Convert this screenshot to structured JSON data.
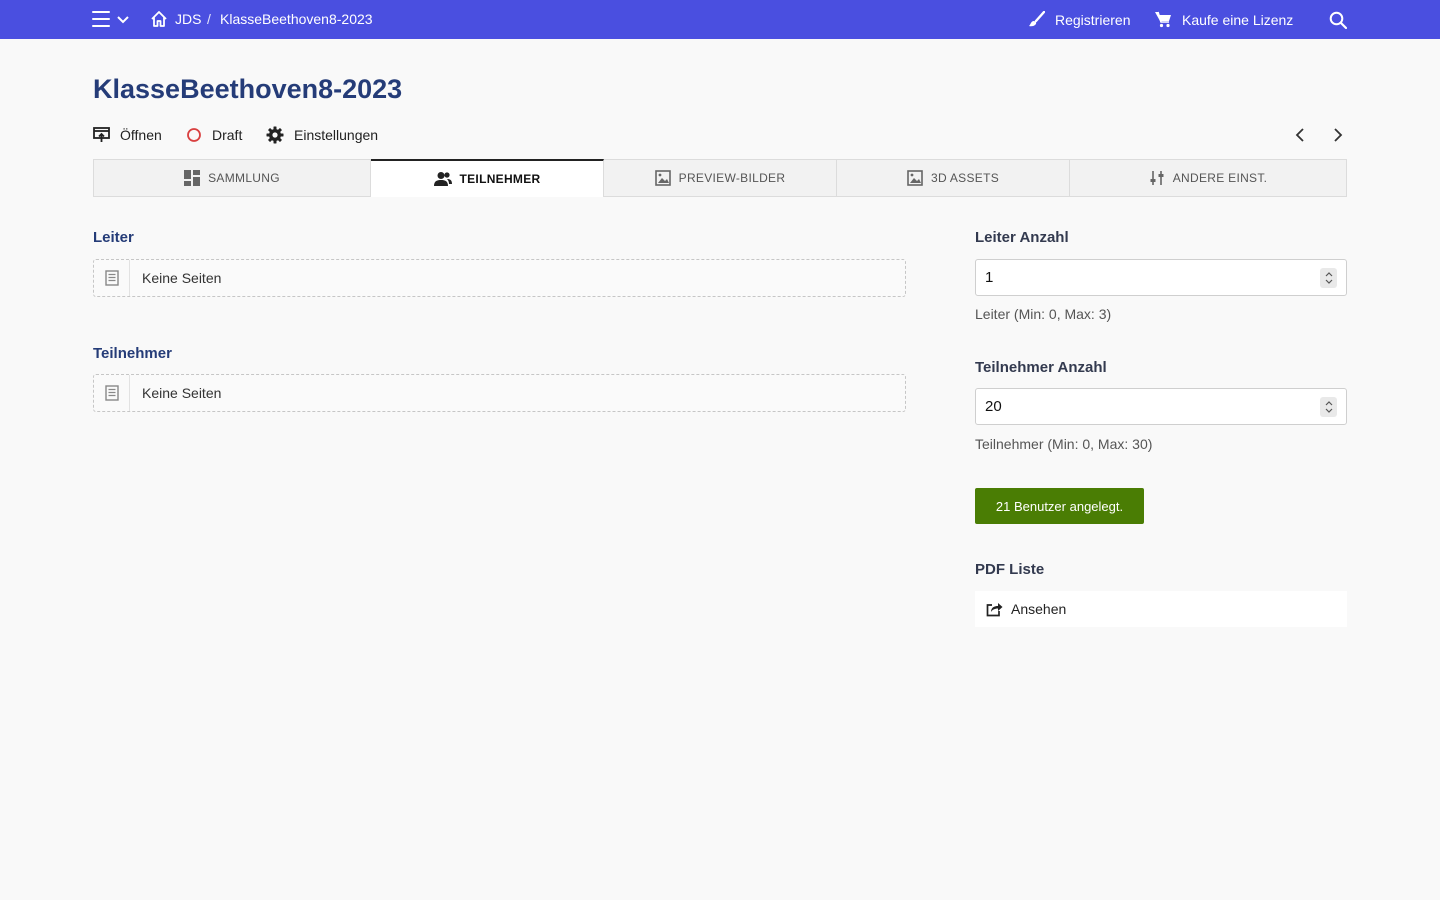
{
  "colors": {
    "topbar": "#4a4fe0",
    "title": "#253c78",
    "success": "#4a7d04",
    "draft": "#d94040"
  },
  "topbar": {
    "menu_icon": "hamburger-icon",
    "breadcrumb": [
      {
        "label": "JDS"
      },
      {
        "label": "KlasseBeethoven8-2023"
      }
    ],
    "separator": "/",
    "register_label": "Registrieren",
    "license_label": "Kaufe eine Lizenz"
  },
  "page": {
    "title": "KlasseBeethoven8-2023",
    "actions": {
      "open_label": "Öffnen",
      "status_label": "Draft",
      "settings_label": "Einstellungen"
    }
  },
  "tabs": [
    {
      "label": "SAMMLUNG",
      "icon": "grid-icon",
      "active": false
    },
    {
      "label": "TEILNEHMER",
      "icon": "users-icon",
      "active": true
    },
    {
      "label": "PREVIEW-BILDER",
      "icon": "image-icon",
      "active": false
    },
    {
      "label": "3D ASSETS",
      "icon": "image-icon",
      "active": false
    },
    {
      "label": "ANDERE EINST.",
      "icon": "sliders-icon",
      "active": false
    }
  ],
  "left": {
    "leader": {
      "label": "Leiter",
      "empty_text": "Keine Seiten"
    },
    "participants": {
      "label": "Teilnehmer",
      "empty_text": "Keine Seiten"
    }
  },
  "right": {
    "leader_count": {
      "label": "Leiter Anzahl",
      "value": "1",
      "hint": "Leiter (Min: 0, Max: 3)"
    },
    "participant_count": {
      "label": "Teilnehmer Anzahl",
      "value": "20",
      "hint": "Teilnehmer (Min: 0, Max: 30)"
    },
    "users_button": "21 Benutzer angelegt.",
    "pdf": {
      "label": "PDF Liste",
      "view_label": "Ansehen"
    }
  }
}
